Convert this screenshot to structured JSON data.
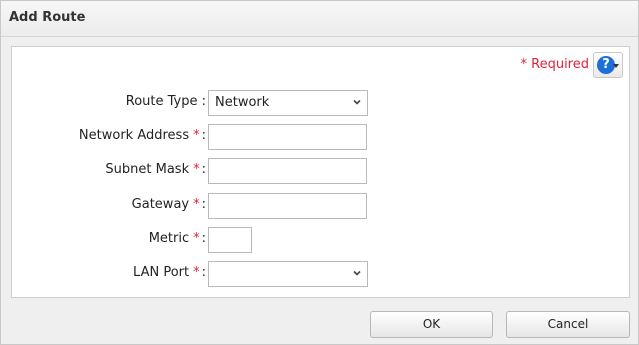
{
  "dialog": {
    "title": "Add Route",
    "required_label": "* Required",
    "help_icon": "question-circle-icon",
    "form": {
      "route_type_label": "Route Type :",
      "route_type_value": "Network",
      "network_address_label": "Network Address",
      "network_address_value": "",
      "subnet_mask_label": "Subnet Mask",
      "subnet_mask_value": "",
      "gateway_label": "Gateway",
      "gateway_value": "",
      "metric_label": "Metric",
      "metric_value": "",
      "lan_port_label": "LAN Port",
      "lan_port_value": "",
      "required_mark": "*",
      "colon": ":"
    },
    "buttons": {
      "ok": "OK",
      "cancel": "Cancel"
    },
    "colors": {
      "required": "#e0233a",
      "help": "#1c6fd6"
    }
  }
}
